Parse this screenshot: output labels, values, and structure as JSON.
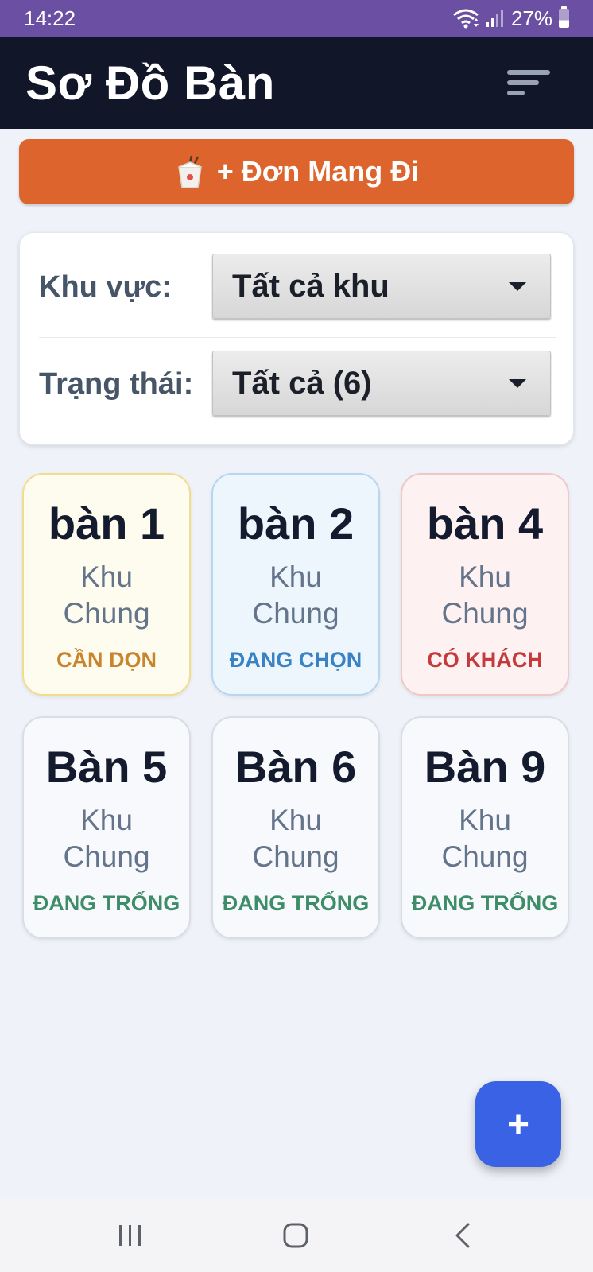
{
  "status_bar": {
    "time": "14:22",
    "battery": "27%",
    "icons": [
      "wifi-icon",
      "signal-icon",
      "battery-icon"
    ]
  },
  "header": {
    "title": "Sơ Đồ Bàn",
    "sort_icon": "sort-icon"
  },
  "takeaway_button": {
    "label": "+ Đơn Mang Đi",
    "icon": "takeout-box-icon",
    "color": "#dd642c"
  },
  "filters": {
    "zone": {
      "label": "Khu vực:",
      "value": "Tất cả khu"
    },
    "status": {
      "label": "Trạng thái:",
      "value": "Tất cả (6)"
    }
  },
  "tables": [
    {
      "name": "bàn 1",
      "zone": "Khu Chung",
      "status": "CẦN DỌN",
      "state": "cleaning"
    },
    {
      "name": "bàn 2",
      "zone": "Khu Chung",
      "status": "ĐANG CHỌN",
      "state": "selecting"
    },
    {
      "name": "bàn 4",
      "zone": "Khu Chung",
      "status": "CÓ KHÁCH",
      "state": "occupied"
    },
    {
      "name": "Bàn 5",
      "zone": "Khu Chung",
      "status": "ĐANG TRỐNG",
      "state": "free"
    },
    {
      "name": "Bàn 6",
      "zone": "Khu Chung",
      "status": "ĐANG TRỐNG",
      "state": "free"
    },
    {
      "name": "Bàn 9",
      "zone": "Khu Chung",
      "status": "ĐANG TRỐNG",
      "state": "free"
    }
  ],
  "fab": {
    "label": "+",
    "color": "#3a62e4"
  },
  "nav": {
    "recent_icon": "recent-apps-icon",
    "home_icon": "home-icon",
    "back_icon": "back-icon"
  }
}
